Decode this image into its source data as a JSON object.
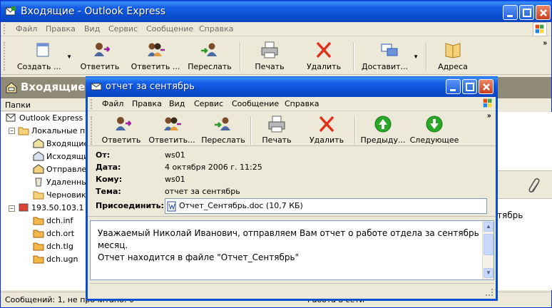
{
  "main": {
    "title": "Входящие - Outlook Express",
    "menu": [
      "Файл",
      "Правка",
      "Вид",
      "Сервис",
      "Сообщение",
      "Справка"
    ],
    "toolbar": {
      "create": "Создать ...",
      "reply": "Ответить",
      "reply_all": "Ответить ...",
      "forward": "Переслать",
      "print": "Печать",
      "delete": "Удалить",
      "deliver": "Доставит...",
      "addresses": "Адреса"
    },
    "header_title": "Входящие",
    "folders_label": "Папки",
    "folders": {
      "root": "Outlook Express",
      "local": "Локальные па",
      "inbox": "Входящие",
      "outbox": "Исходящие",
      "sent": "Отправлен",
      "deleted": "Удаленны",
      "drafts": "Черновики",
      "server": "193.50.103.1 (",
      "f1": "dch.inf",
      "f2": "dch.ort",
      "f3": "dch.tlg",
      "f4": "dch.ugn"
    },
    "preview_fragment": "тябрь",
    "status": {
      "left": "Сообщений: 1, не прочитано: 0",
      "right": "Работа в сети"
    }
  },
  "message": {
    "title": "отчет за сентябрь",
    "menu": [
      "Файл",
      "Правка",
      "Вид",
      "Сервис",
      "Сообщение",
      "Справка"
    ],
    "toolbar": {
      "reply": "Ответить",
      "reply_all": "Ответить...",
      "forward": "Переслать",
      "print": "Печать",
      "delete": "Удалить",
      "previous": "Предыду...",
      "next": "Следующее"
    },
    "headers": {
      "from_label": "От:",
      "from": "ws01",
      "date_label": "Дата:",
      "date": "4 октября 2006 г. 11:25",
      "to_label": "Кому:",
      "to": "ws01",
      "subject_label": "Тема:",
      "subject": "отчет за сентябрь",
      "attach_label": "Присоединить:",
      "attach": "Отчет_Сентябрь.doc (10,7 КБ)"
    },
    "body": [
      "Уважаемый Николай Иванович, отправляем Вам отчет о работе отдела за сентябрь",
      "месяц.",
      "Отчет находится  в файле \"Отчет_Сентябрь\""
    ]
  }
}
